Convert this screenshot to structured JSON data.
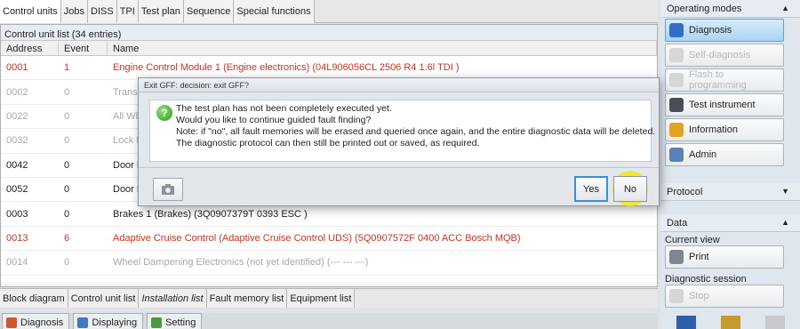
{
  "top_tabs": [
    "Control units",
    "Jobs",
    "DISS",
    "TPI",
    "Test plan",
    "Sequence",
    "Special functions"
  ],
  "panel": {
    "title": "Control unit list (34 entries)",
    "columns": [
      "Address",
      "Event",
      "Name"
    ],
    "rows": [
      {
        "address": "0001",
        "event": "1",
        "name": "Engine Control Module 1 (Engine electronics) (04L906056CL    2506   R4 1.6l TDI  )"
      },
      {
        "address": "0002",
        "event": "0",
        "name": "Trans"
      },
      {
        "address": "0022",
        "event": "0",
        "name": "All Wh"
      },
      {
        "address": "0032",
        "event": "0",
        "name": "Lock E"
      },
      {
        "address": "0042",
        "event": "0",
        "name": "Door E"
      },
      {
        "address": "0052",
        "event": "0",
        "name": "Door E"
      },
      {
        "address": "0003",
        "event": "0",
        "name": "Brakes 1 (Brakes) (3Q0907379T    0393   ESC        )"
      },
      {
        "address": "0013",
        "event": "6",
        "name": "Adaptive Cruise Control (Adaptive Cruise Control UDS) (5Q0907572F    0400   ACC Bosch MQB)"
      },
      {
        "address": "0014",
        "event": "0",
        "name": "Wheel Dampening Electronics (not yet identified) (---   ---   ---)"
      }
    ]
  },
  "bottom_tabs": [
    "Block diagram",
    "Control unit list",
    "Installation list",
    "Fault memory list",
    "Equipment list"
  ],
  "status_bar": {
    "diagnosis": "Diagnosis",
    "displaying": "Displaying",
    "setting": "Setting"
  },
  "right_panel": {
    "operating_modes": "Operating modes",
    "diagnosis": "Diagnosis",
    "self_diagnosis": "Self-diagnosis",
    "flash": "Flash to programming",
    "test_instrument": "Test instrument",
    "information": "Information",
    "admin": "Admin",
    "protocol": "Protocol",
    "data": "Data",
    "current_view": "Current view",
    "print": "Print",
    "diagnostic_session": "Diagnostic session",
    "stop": "Stop"
  },
  "dialog": {
    "title": "Exit GFF: decision: exit GFF?",
    "lines": [
      "The test plan has not been completely executed yet.",
      "Would you like to continue guided fault finding?",
      "Note: if \"no\", all fault memories will be erased and queried once again, and the entire diagnostic data will be deleted.",
      "The diagnostic protocol can then still be printed out or saved, as required."
    ],
    "yes": "Yes",
    "no": "No"
  },
  "colors": {
    "fault": "#d8311f",
    "inactive": "#a8a8a8",
    "accent": "#3a8fd6"
  },
  "icons": {
    "question": "question-icon",
    "camera": "camera-icon"
  }
}
